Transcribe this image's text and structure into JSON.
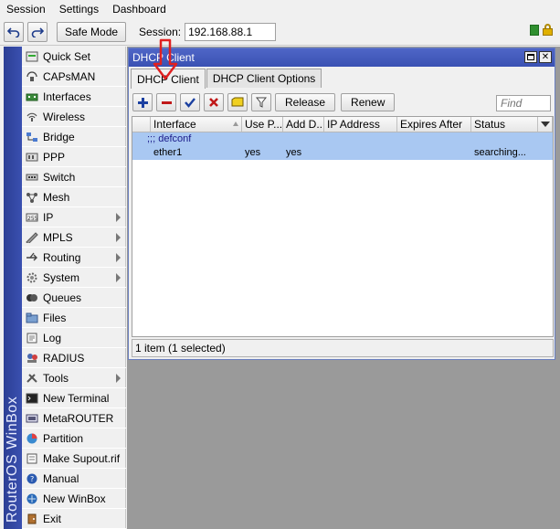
{
  "menubar": {
    "items": [
      "Session",
      "Settings",
      "Dashboard"
    ]
  },
  "toolbar": {
    "safe_mode_label": "Safe Mode",
    "session_label": "Session:",
    "session_value": "192.168.88.1"
  },
  "sidebar": {
    "brand": "RouterOS WinBox",
    "items": [
      {
        "label": "Quick Set",
        "icon": "quick-set-icon",
        "submenu": false
      },
      {
        "label": "CAPsMAN",
        "icon": "capsman-icon",
        "submenu": false
      },
      {
        "label": "Interfaces",
        "icon": "interfaces-icon",
        "submenu": false
      },
      {
        "label": "Wireless",
        "icon": "wireless-icon",
        "submenu": false
      },
      {
        "label": "Bridge",
        "icon": "bridge-icon",
        "submenu": false
      },
      {
        "label": "PPP",
        "icon": "ppp-icon",
        "submenu": false
      },
      {
        "label": "Switch",
        "icon": "switch-icon",
        "submenu": false
      },
      {
        "label": "Mesh",
        "icon": "mesh-icon",
        "submenu": false
      },
      {
        "label": "IP",
        "icon": "ip-icon",
        "submenu": true
      },
      {
        "label": "MPLS",
        "icon": "mpls-icon",
        "submenu": true
      },
      {
        "label": "Routing",
        "icon": "routing-icon",
        "submenu": true
      },
      {
        "label": "System",
        "icon": "system-gear-icon",
        "submenu": true
      },
      {
        "label": "Queues",
        "icon": "queues-icon",
        "submenu": false
      },
      {
        "label": "Files",
        "icon": "folder-icon",
        "submenu": false
      },
      {
        "label": "Log",
        "icon": "log-icon",
        "submenu": false
      },
      {
        "label": "RADIUS",
        "icon": "radius-icon",
        "submenu": false
      },
      {
        "label": "Tools",
        "icon": "tools-icon",
        "submenu": true
      },
      {
        "label": "New Terminal",
        "icon": "terminal-icon",
        "submenu": false
      },
      {
        "label": "MetaROUTER",
        "icon": "metarouter-icon",
        "submenu": false
      },
      {
        "label": "Partition",
        "icon": "partition-icon",
        "submenu": false
      },
      {
        "label": "Make Supout.rif",
        "icon": "supout-icon",
        "submenu": false
      },
      {
        "label": "Manual",
        "icon": "manual-icon",
        "submenu": false
      },
      {
        "label": "New WinBox",
        "icon": "winbox-icon",
        "submenu": false
      },
      {
        "label": "Exit",
        "icon": "exit-icon",
        "submenu": false
      }
    ]
  },
  "window": {
    "title": "DHCP Client",
    "tabs": [
      "DHCP Client",
      "DHCP Client Options"
    ],
    "release_label": "Release",
    "renew_label": "Renew",
    "find_placeholder": "Find",
    "columns": [
      "Interface",
      "Use P...",
      "Add D...",
      "IP Address",
      "Expires After",
      "Status"
    ],
    "comment_row": ";;; defconf",
    "rows": [
      {
        "interface": "ether1",
        "use_peer": "yes",
        "add_default": "yes",
        "ip": "",
        "expires": "",
        "status": "searching..."
      }
    ],
    "status_text": "1 item (1 selected)"
  },
  "colors": {
    "title_bar": "#3a51b3",
    "selection": "#a9c8f2",
    "annotation_arrow": "#e02020"
  }
}
